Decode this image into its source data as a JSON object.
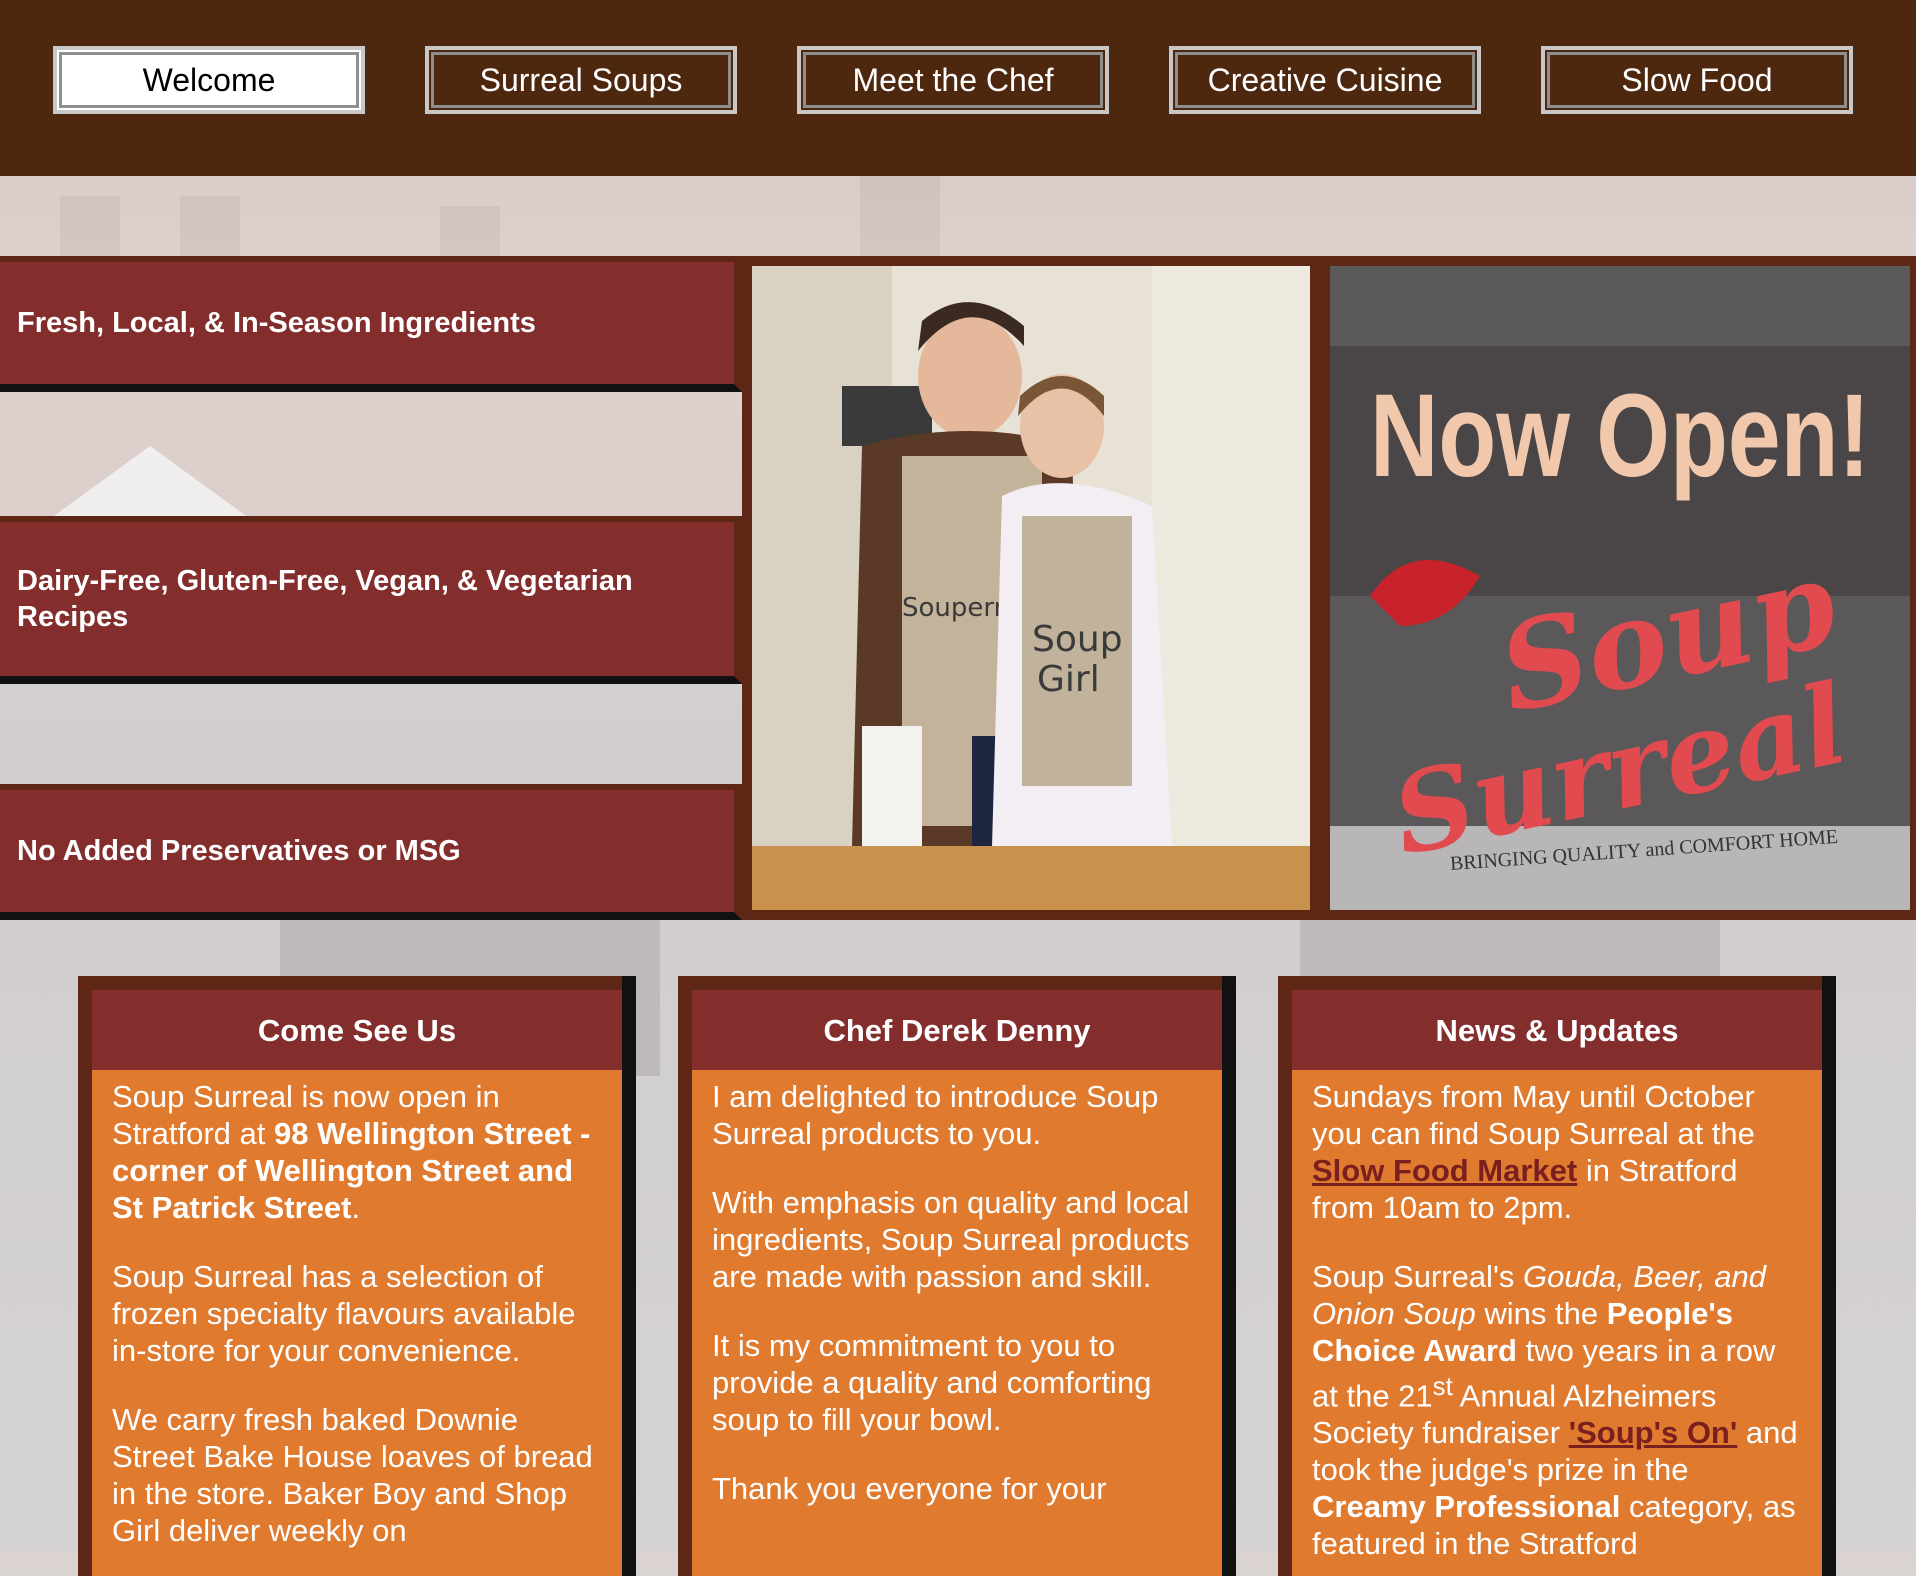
{
  "nav": {
    "items": [
      {
        "label": "Welcome",
        "active": true
      },
      {
        "label": "Surreal Soups",
        "active": false
      },
      {
        "label": "Meet the Chef",
        "active": false
      },
      {
        "label": "Creative Cuisine",
        "active": false
      },
      {
        "label": "Slow Food",
        "active": false
      }
    ]
  },
  "features": [
    "Fresh, Local, & In-Season Ingredients",
    "Dairy-Free, Gluten-Free, Vegan, & Vegetarian Recipes",
    "No Added Preservatives or MSG"
  ],
  "chef_photo": {
    "apron_left": "Souperman",
    "apron_right_1": "Soup",
    "apron_right_2": "Girl"
  },
  "sign_photo": {
    "headline": "Now Open!",
    "brand_1": "Soup",
    "brand_2": "Surreal",
    "tagline": "BRINGING QUALITY and COMFORT HOME"
  },
  "cards": {
    "come_see_us": {
      "title": "Come See Us",
      "p1_text": "Soup Surreal is now open in Stratford at ",
      "p1_bold": "98 Wellington Street - corner of Wellington Street and St Patrick Street",
      "p1_end": ".",
      "p2": "Soup Surreal has a selection of frozen specialty flavours available in-store for your convenience.",
      "p3": "We carry fresh baked Downie Street Bake House loaves of bread in the store. Baker Boy and Shop Girl deliver weekly on"
    },
    "chef": {
      "title": "Chef Derek Denny",
      "p1": "I am delighted to introduce Soup Surreal products to you.",
      "p2": "With emphasis on quality and local ingredients, Soup Surreal products are made with passion and skill.",
      "p3": "It is my commitment to you to provide a quality and comforting soup to fill your bowl.",
      "p4": "Thank you everyone for your"
    },
    "news": {
      "title": "News & Updates",
      "p1_a": "Sundays from May until October you can find Soup Surreal at the ",
      "p1_link": "Slow Food Market",
      "p1_b": " in Stratford from 10am to 2pm.",
      "p2_a": "Soup Surreal's ",
      "p2_italic": "Gouda, Beer, and Onion Soup",
      "p2_b": " wins the ",
      "p2_bold1": "People's Choice Award",
      "p2_c": " two years in a row at the 21",
      "p2_sup": "st",
      "p2_d": " Annual Alzheimers Society fundraiser ",
      "p2_link": "'Soup's On'",
      "p2_e": " and took the judge's prize in the ",
      "p2_bold2": "Creamy Professional",
      "p2_f": " category, as featured in the Stratford"
    }
  }
}
